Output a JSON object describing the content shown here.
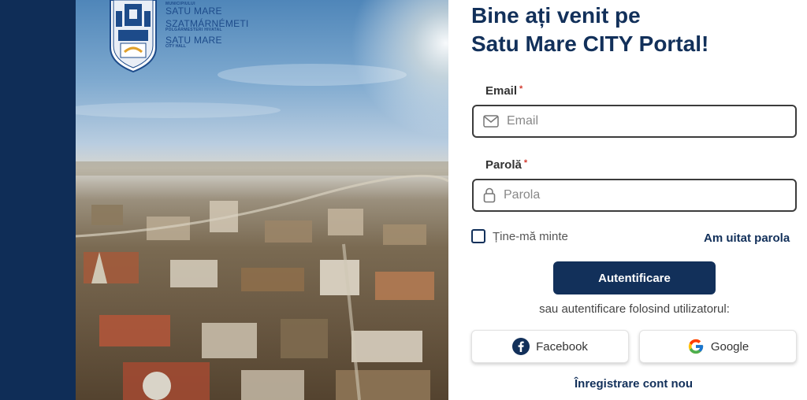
{
  "crest": {
    "line1": "MUNICIPIULUI",
    "line2": "SATU MARE",
    "line3": "SZATMÁRNÉMETI",
    "line4": "POLGÁRMESTERI HIVATAL",
    "line5": "SATU MARE",
    "line6": "CITY HALL"
  },
  "title": {
    "line1": "Bine ați venit pe",
    "line2": "Satu Mare CITY Portal!"
  },
  "email": {
    "label": "Email",
    "required_mark": "*",
    "placeholder": "Email",
    "value": ""
  },
  "password": {
    "label": "Parolă",
    "required_mark": "*",
    "placeholder": "Parola",
    "value": ""
  },
  "remember_me": {
    "label": "Ține-mă minte",
    "checked": false
  },
  "forgot_password": "Am uitat parola",
  "login_button": "Autentificare",
  "alt_login_text": "sau autentificare folosind utilizatorul:",
  "social": {
    "facebook": "Facebook",
    "google": "Google"
  },
  "register_link": "Înregistrare cont nou",
  "colors": {
    "primary": "#12305a",
    "sidebar": "#0f2d57",
    "required": "#d23a2f",
    "facebook": "#1877f2"
  }
}
